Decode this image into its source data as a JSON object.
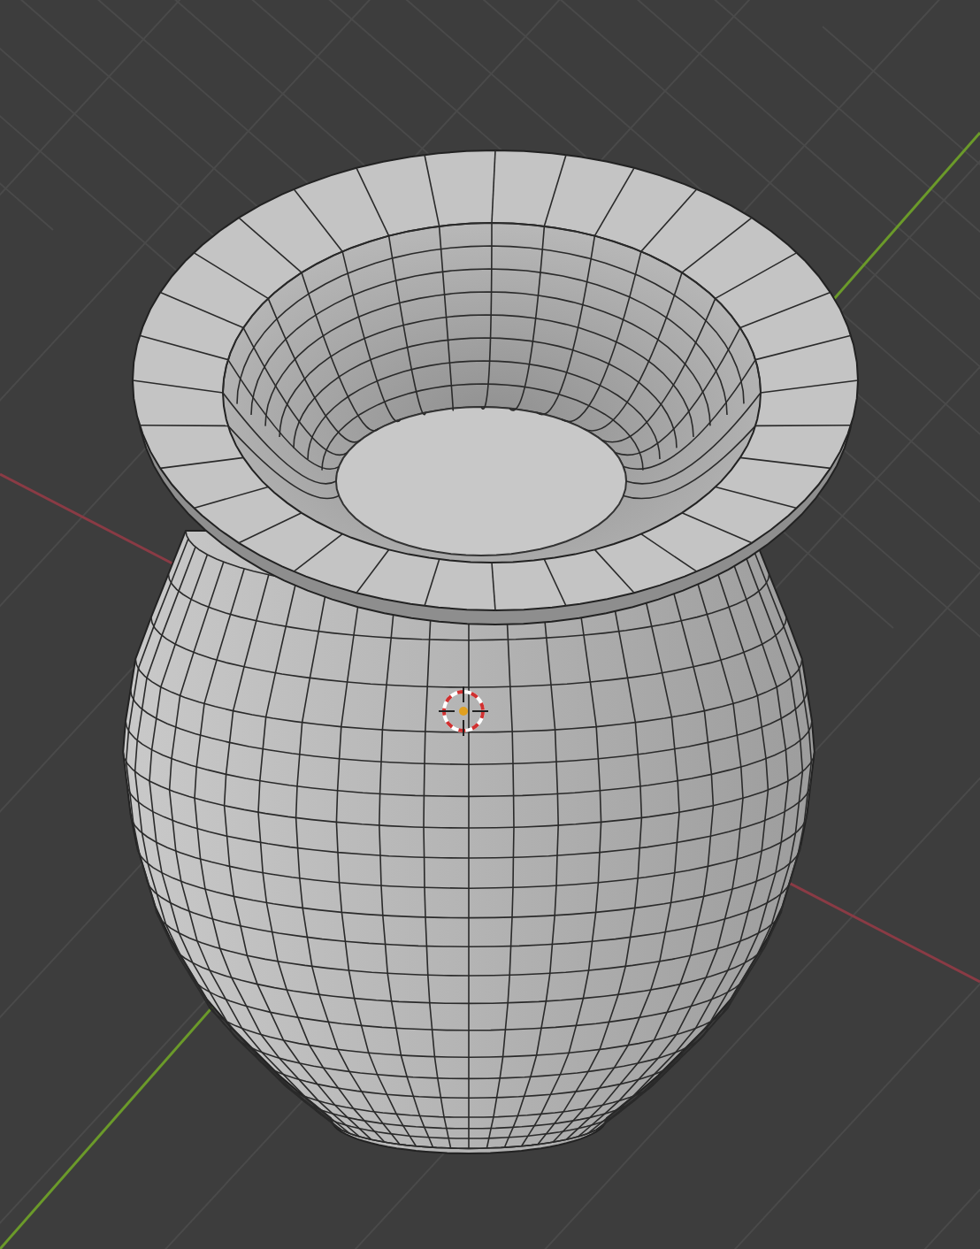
{
  "viewport": {
    "solid_shading": true,
    "show_grid": true,
    "show_cursor": true
  }
}
